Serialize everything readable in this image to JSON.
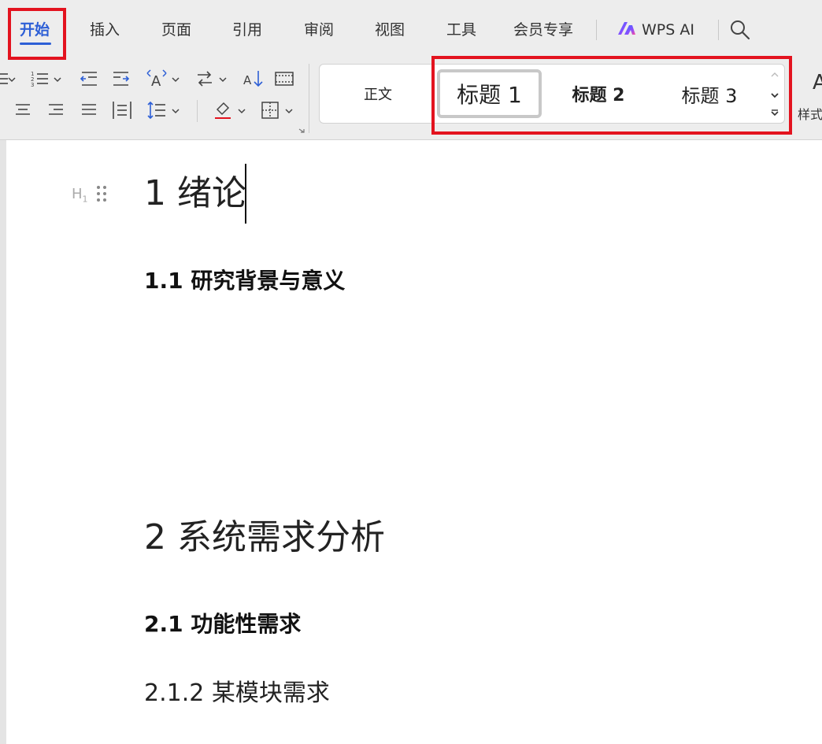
{
  "menubar": {
    "tabs": [
      {
        "label": "开始",
        "active": true
      },
      {
        "label": "插入"
      },
      {
        "label": "页面"
      },
      {
        "label": "引用"
      },
      {
        "label": "审阅"
      },
      {
        "label": "视图"
      },
      {
        "label": "工具"
      },
      {
        "label": "会员专享"
      }
    ],
    "wps_ai": "WPS AI",
    "search_icon": "search-icon"
  },
  "ribbon": {
    "styles": {
      "normal": "正文",
      "heading1": "标题 1",
      "heading2": "标题 2",
      "heading3": "标题 3"
    },
    "styles_more_label": "样式"
  },
  "document": {
    "heading_marker": "H",
    "heading_marker_sub": "1",
    "lines": {
      "h1_intro": "1 绪论",
      "h2_background": "1.1  研究背景与意义",
      "h1_requirements": "2 系统需求分析",
      "h2_functional": "2.1  功能性需求",
      "h3_module": "2.1.2  某模块需求"
    }
  },
  "colors": {
    "accent_blue": "#2d5fd6",
    "highlight_red": "#e3131f",
    "menubar_bg": "#ededed"
  }
}
